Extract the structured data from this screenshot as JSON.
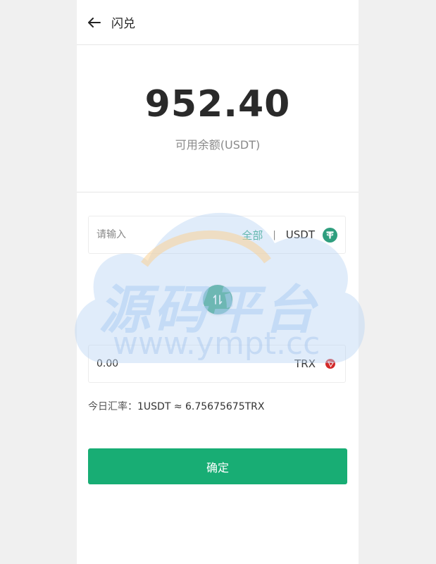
{
  "header": {
    "title": "闪兑"
  },
  "balance": {
    "amount": "952.40",
    "label": "可用余额(USDT)"
  },
  "from": {
    "placeholder": "请输入",
    "all_label": "全部",
    "separator": "|",
    "coin": "USDT"
  },
  "to": {
    "value": "0.00",
    "coin": "TRX"
  },
  "rate": {
    "label": "今日汇率：",
    "value": "1USDT ≈ 6.75675675TRX"
  },
  "confirm_label": "确定",
  "watermark": {
    "text": "源码平台",
    "url": "www.ympt.cc"
  },
  "colors": {
    "accent": "#18ad74",
    "usdt": "#2f9e7e",
    "trx": "#d32a2a"
  },
  "icons": {
    "back": "arrow-left-icon",
    "swap": "swap-icon",
    "usdt": "tether-icon",
    "trx": "tron-icon"
  }
}
